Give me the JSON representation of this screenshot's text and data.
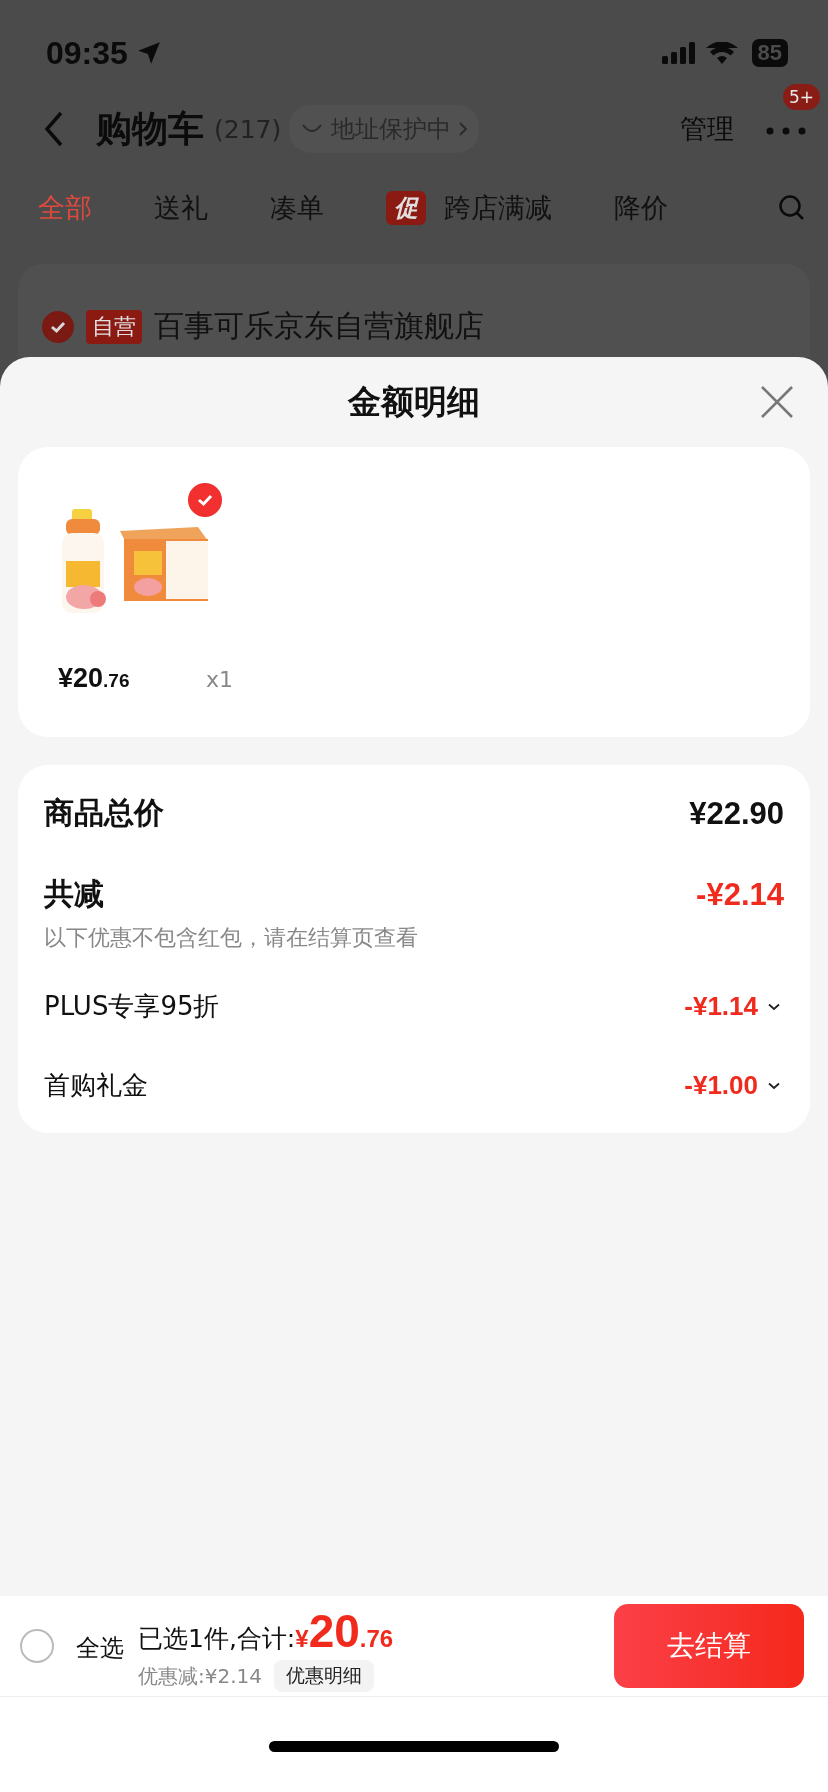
{
  "status_bar": {
    "time": "09:35",
    "battery": "85"
  },
  "header": {
    "title": "购物车",
    "count": "(217)",
    "address_badge": "地址保护中",
    "manage": "管理",
    "more_badge": "5+"
  },
  "tabs": [
    {
      "label": "全部",
      "selected": true
    },
    {
      "label": "送礼",
      "selected": false
    },
    {
      "label": "凑单",
      "selected": false
    },
    {
      "label": "跨店满减",
      "selected": false,
      "tag": "促"
    },
    {
      "label": "降价",
      "selected": false
    }
  ],
  "store": {
    "checked": true,
    "tag": "自营",
    "name": "百事可乐京东自营旗舰店"
  },
  "sheet": {
    "title": "金额明细",
    "product": {
      "checked": true,
      "price": "¥20",
      "price_decimal": ".76",
      "quantity": "x1"
    },
    "summary": {
      "total_label": "商品总价",
      "total_value": "¥22.90",
      "reduction_label": "共减",
      "reduction_value": "-¥2.14",
      "hint": "以下优惠不包含红包，请在结算页查看",
      "discounts": [
        {
          "label": "PLUS专享95折",
          "value": "-¥1.14"
        },
        {
          "label": "首购礼金",
          "value": "-¥1.00"
        }
      ]
    }
  },
  "bottom_bar": {
    "select_all": {
      "label": "全选",
      "checked": false
    },
    "selected_text": "已选1件,合计:",
    "currency": "¥",
    "total": "20",
    "total_decimal": ".76",
    "saving": "优惠减:¥2.14",
    "detail_button": "优惠明细",
    "checkout": "去结算"
  }
}
